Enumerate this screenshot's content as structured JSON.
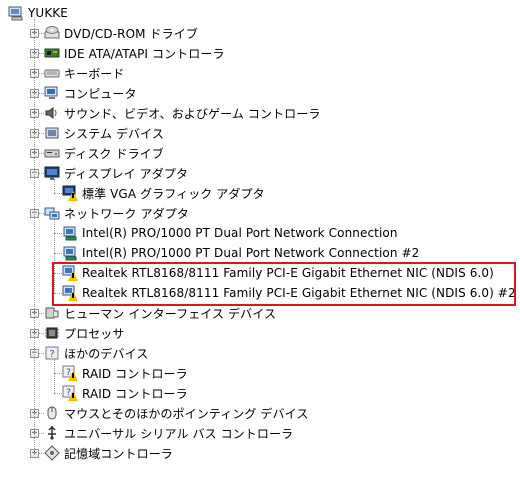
{
  "root": {
    "label": "YUKKE",
    "icon": "computer-root-icon"
  },
  "tree": [
    {
      "label": "DVD/CD-ROM ドライブ",
      "icon": "cdrom-icon",
      "expanded": false
    },
    {
      "label": "IDE ATA/ATAPI コントローラ",
      "icon": "ide-controller-icon",
      "expanded": false
    },
    {
      "label": "キーボード",
      "icon": "keyboard-icon",
      "expanded": false
    },
    {
      "label": "コンピュータ",
      "icon": "computer-icon",
      "expanded": false
    },
    {
      "label": "サウンド、ビデオ、およびゲーム コントローラ",
      "icon": "speaker-icon",
      "expanded": false
    },
    {
      "label": "システム デバイス",
      "icon": "system-device-icon",
      "expanded": false
    },
    {
      "label": "ディスク ドライブ",
      "icon": "disk-drive-icon",
      "expanded": false
    },
    {
      "label": "ディスプレイ アダプタ",
      "icon": "display-adapter-icon",
      "expanded": true,
      "children": [
        {
          "label": "標準 VGA グラフィック アダプタ",
          "icon": "display-warning-icon"
        }
      ]
    },
    {
      "label": "ネットワーク アダプタ",
      "icon": "network-adapter-icon",
      "expanded": true,
      "children": [
        {
          "label": "Intel(R) PRO/1000 PT Dual Port Network Connection",
          "icon": "network-card-icon"
        },
        {
          "label": "Intel(R) PRO/1000 PT Dual Port Network Connection #2",
          "icon": "network-card-icon"
        },
        {
          "label": "Realtek RTL8168/8111 Family PCI-E Gigabit Ethernet NIC (NDIS 6.0)",
          "icon": "network-warning-icon"
        },
        {
          "label": "Realtek RTL8168/8111 Family PCI-E Gigabit Ethernet NIC (NDIS 6.0) #2",
          "icon": "network-warning-icon"
        }
      ]
    },
    {
      "label": "ヒューマン インターフェイス デバイス",
      "icon": "hid-icon",
      "expanded": false
    },
    {
      "label": "プロセッサ",
      "icon": "processor-icon",
      "expanded": false
    },
    {
      "label": "ほかのデバイス",
      "icon": "other-devices-icon",
      "expanded": true,
      "children": [
        {
          "label": "RAID コントローラ",
          "icon": "unknown-warning-icon"
        },
        {
          "label": "RAID コントローラ",
          "icon": "unknown-warning-icon"
        }
      ]
    },
    {
      "label": "マウスとそのほかのポインティング デバイス",
      "icon": "mouse-icon",
      "expanded": false
    },
    {
      "label": "ユニバーサル シリアル バス コントローラ",
      "icon": "usb-icon",
      "expanded": false
    },
    {
      "label": "記憶域コントローラ",
      "icon": "storage-controller-icon",
      "expanded": false
    }
  ],
  "expander": {
    "collapsed": "+",
    "expanded": "−"
  },
  "highlight_color": "#e0141e"
}
